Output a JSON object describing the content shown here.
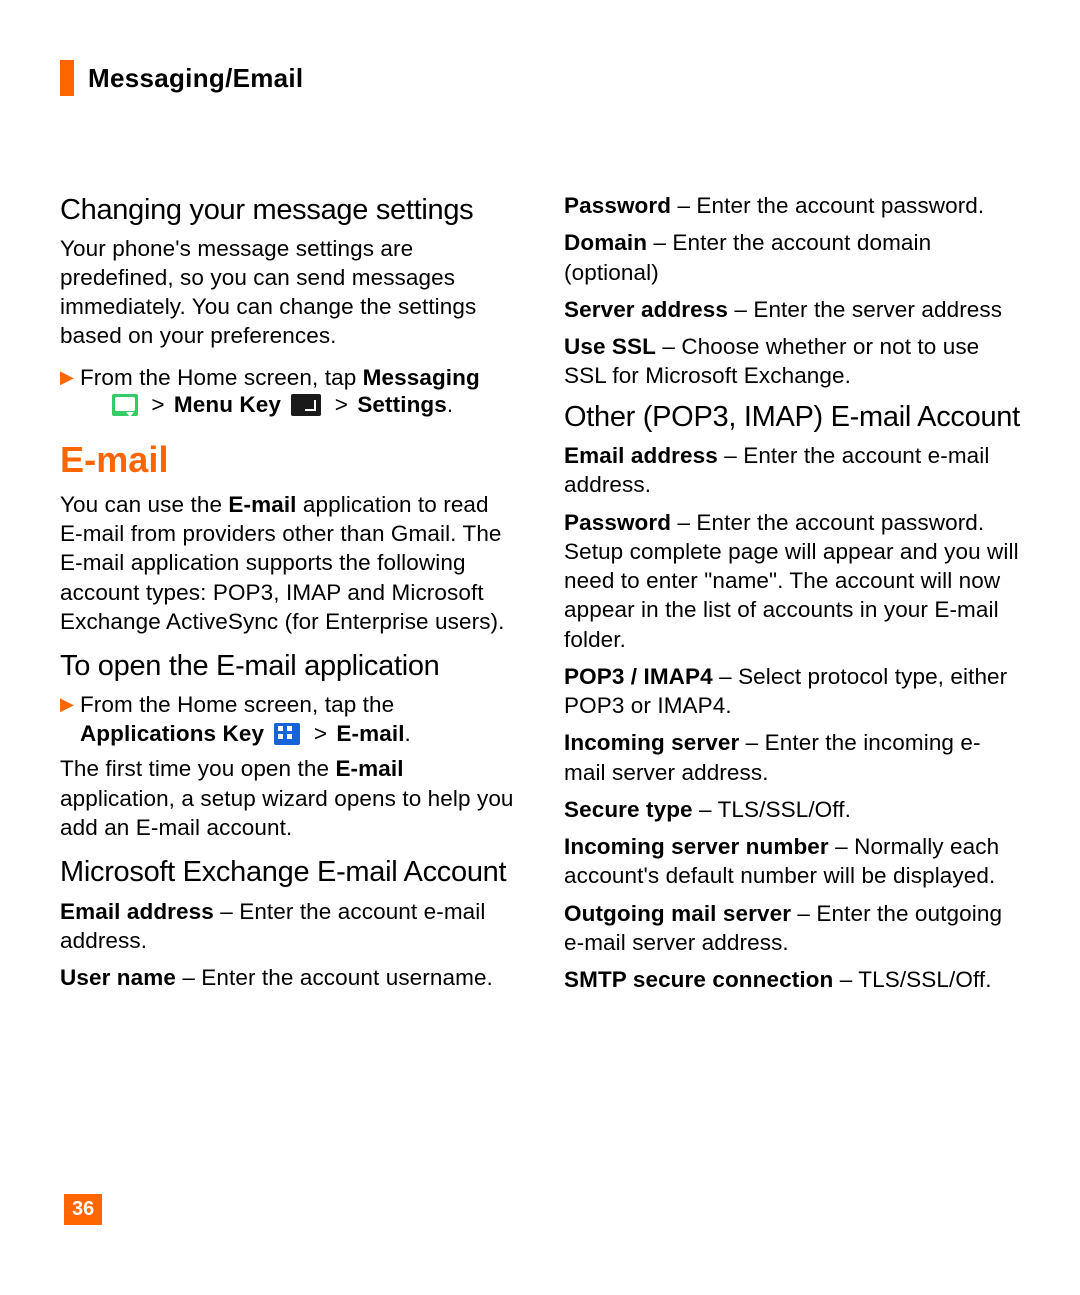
{
  "header": {
    "title": "Messaging/Email"
  },
  "col1": {
    "h_changing": "Changing your message settings",
    "p_changing1": "Your phone's message settings are predefined, so you can send messages immediately. You can change the settings based on your preferences.",
    "bullet1_pre": "From the Home screen, tap ",
    "bullet1_bold1": "Messaging",
    "bullet1_menu": "Menu Key",
    "bullet1_settings": "Settings",
    "h_email": "E-mail",
    "p_email1_a": "You can use the ",
    "p_email1_bold": "E-mail",
    "p_email1_b": " application to read E-mail from providers other than Gmail. The E-mail application supports the following account types: POP3, IMAP and Microsoft Exchange ActiveSync (for Enterprise users).",
    "h_openemail": "To open the E-mail application",
    "bullet2_pre": "From the Home screen, tap the ",
    "bullet2_bold1": "Applications Key",
    "bullet2_bold2": "E-mail",
    "p_firsttime_a": "The first time you open the ",
    "p_firsttime_bold": "E-mail",
    "p_firsttime_b": " application, a setup wizard opens to help you add an E-mail account.",
    "h_msex": "Microsoft Exchange E-mail Account",
    "def_email_label": "Email address",
    "def_email_text": " – Enter the account e-mail address.",
    "def_user_label": "User name",
    "def_user_text": " – Enter the account username."
  },
  "col2": {
    "def_pw_label": "Password",
    "def_pw_text": " – Enter the account password.",
    "def_domain_label": "Domain",
    "def_domain_text": " – Enter the account domain (optional)",
    "def_server_label": "Server address",
    "def_server_text": " – Enter the server address",
    "def_ssl_label": "Use SSL",
    "def_ssl_text": " – Choose whether or not to use SSL for Microsoft Exchange.",
    "h_other": "Other (POP3, IMAP) E-mail Account",
    "def_email2_label": "Email address",
    "def_email2_text": " – Enter the account e-mail address.",
    "def_pw2_label": "Password",
    "def_pw2_text": " – Enter the account password. Setup complete page will appear and you will need to enter \"name\". The account will now appear in the list of accounts in your E-mail folder.",
    "def_pop_label": "POP3 / IMAP4",
    "def_pop_text": " – Select protocol type, either POP3 or IMAP4.",
    "def_inc_label": "Incoming server",
    "def_inc_text": " – Enter the incoming e-mail server address.",
    "def_sec_label": "Secure type",
    "def_sec_text": " – TLS/SSL/Off.",
    "def_incnum_label": "Incoming server number",
    "def_incnum_text": " – Normally each account's default number will be displayed.",
    "def_out_label": "Outgoing mail server",
    "def_out_text": " – Enter the outgoing e-mail server address.",
    "def_smtp_label": "SMTP secure connection",
    "def_smtp_text": " – TLS/SSL/Off."
  },
  "page_number": "36",
  "symbols": {
    "gt": ">",
    "bullet": "▶",
    "period": "."
  }
}
